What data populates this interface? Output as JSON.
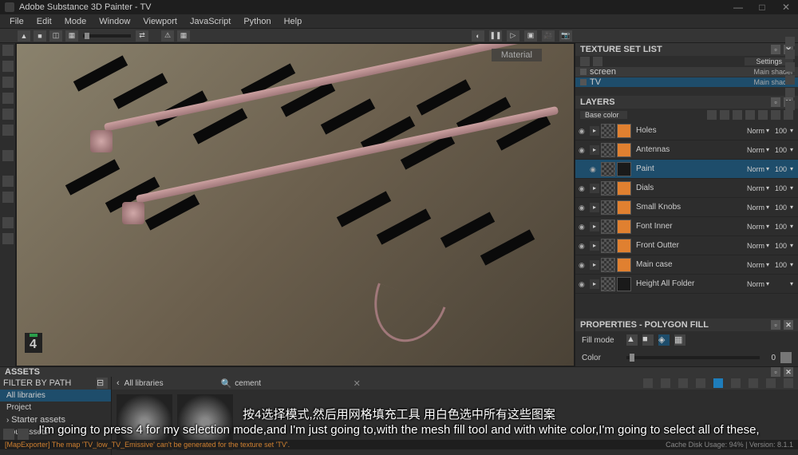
{
  "title": "Adobe Substance 3D Painter - TV",
  "menu": [
    "File",
    "Edit",
    "Mode",
    "Window",
    "Viewport",
    "JavaScript",
    "Python",
    "Help"
  ],
  "panels": {
    "texture_set": {
      "title": "TEXTURE SET LIST",
      "settings": "Settings",
      "items": [
        {
          "name": "screen",
          "shader": "Main shader",
          "selected": false
        },
        {
          "name": "TV",
          "shader": "Main shader",
          "selected": true
        }
      ]
    },
    "layers": {
      "title": "LAYERS",
      "channel": "Base color",
      "items": [
        {
          "name": "Holes",
          "blend": "Norm",
          "opac": "100",
          "indent": 0,
          "folder": true,
          "thumb": "or"
        },
        {
          "name": "Antennas",
          "blend": "Norm",
          "opac": "100",
          "indent": 0,
          "folder": true,
          "thumb": "or"
        },
        {
          "name": "Paint",
          "blend": "Norm",
          "opac": "100",
          "indent": 1,
          "folder": false,
          "selected": true,
          "thumb": "dark"
        },
        {
          "name": "Dials",
          "blend": "Norm",
          "opac": "100",
          "indent": 0,
          "folder": true,
          "thumb": "or"
        },
        {
          "name": "Small Knobs",
          "blend": "Norm",
          "opac": "100",
          "indent": 0,
          "folder": true,
          "thumb": "or"
        },
        {
          "name": "Font Inner",
          "blend": "Norm",
          "opac": "100",
          "indent": 0,
          "folder": true,
          "thumb": "or"
        },
        {
          "name": "Front Outter",
          "blend": "Norm",
          "opac": "100",
          "indent": 0,
          "folder": true,
          "thumb": "or"
        },
        {
          "name": "Main case",
          "blend": "Norm",
          "opac": "100",
          "indent": 0,
          "folder": true,
          "thumb": "or"
        },
        {
          "name": "Height All Folder",
          "blend": "Norm",
          "opac": "",
          "indent": 0,
          "folder": true,
          "thumb": "dark"
        }
      ]
    },
    "properties": {
      "title": "PROPERTIES - POLYGON FILL",
      "fill_mode": "Fill mode",
      "color": "Color",
      "color_value": "0"
    },
    "assets": {
      "title": "ASSETS",
      "filter": "FILTER BY PATH",
      "tree": [
        "All libraries",
        "Project",
        "Starter assets",
        "Your assets"
      ],
      "crumb": "All libraries",
      "search": "cement"
    }
  },
  "viewport": {
    "overlay": "Material",
    "mode": "4"
  },
  "subtitles": {
    "cn": "按4选择模式,然后用网格填充工具 用白色选中所有这些图案",
    "en": "I'm going to press 4 for my selection mode,and I'm just going to,with the mesh fill tool and with white color,I'm going to select all of these,"
  },
  "status": {
    "warn": "[MapExporter] The map 'TV_low_TV_Emissive' can't be generated for the texture set 'TV'.",
    "info": "Cache Disk Usage:   94% | Version: 8.1.1"
  }
}
